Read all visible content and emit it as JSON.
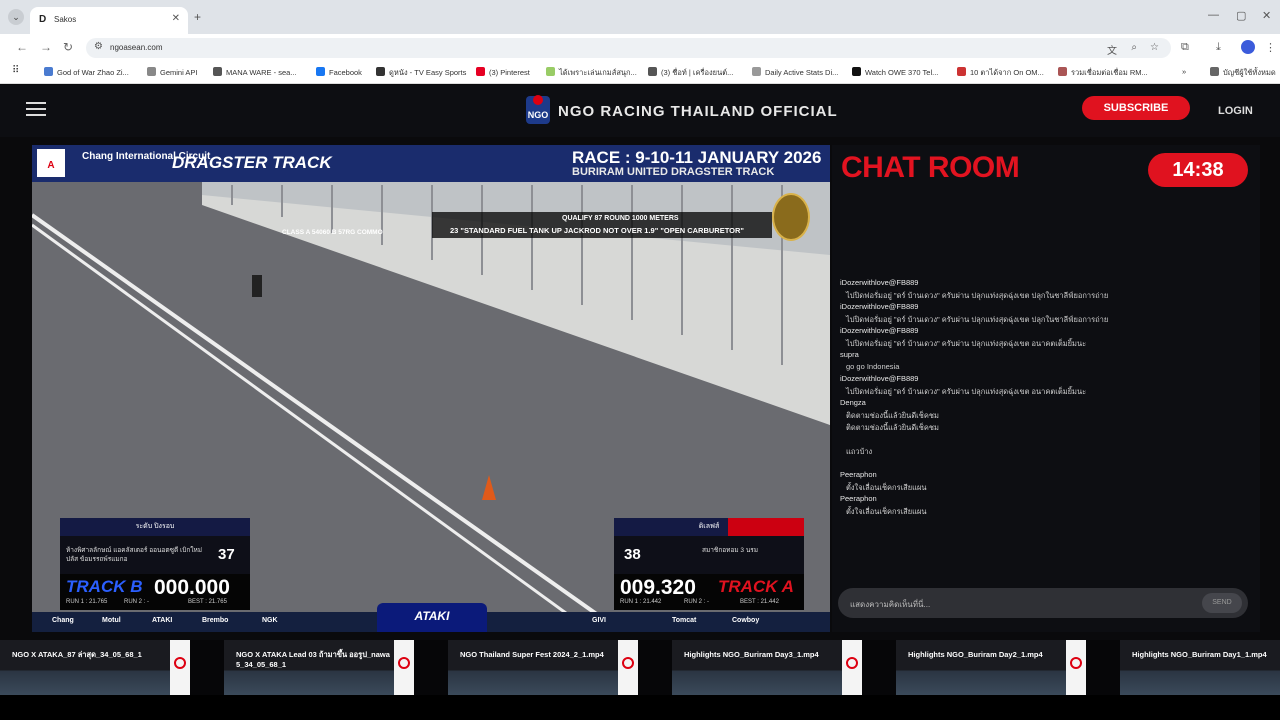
{
  "browser": {
    "tab_title": "Sakos",
    "url": "ngoasean.com",
    "bookmarks": [
      {
        "label": "God of War Zhao Zi...",
        "color": "#4a7bd0"
      },
      {
        "label": "Gemini API",
        "color": "#888"
      },
      {
        "label": "MANA WARE - sea...",
        "color": "#555"
      },
      {
        "label": "Facebook",
        "color": "#1877f2"
      },
      {
        "label": "ดูหนัง - TV Easy Sports",
        "color": "#333"
      },
      {
        "label": "(3) Pinterest",
        "color": "#e60023"
      },
      {
        "label": "ได้เพราะเล่นเกมส์สนุก...",
        "color": "#9c6"
      },
      {
        "label": "(3) ชื่อท์ | เครื่องยนต์...",
        "color": "#555"
      },
      {
        "label": "Daily Active Stats Di...",
        "color": "#999"
      },
      {
        "label": "Watch OWE 370 Tel...",
        "color": "#111"
      },
      {
        "label": "10 ตาได้จาก On OM...",
        "color": "#c33"
      },
      {
        "label": "รวมเชื่อมต่อเชื่อม RM...",
        "color": "#a55"
      },
      {
        "label": "บัญชีผู้ใช้ทั้งหมด",
        "color": "#666"
      }
    ]
  },
  "site": {
    "title": "NGO RACING THAILAND OFFICIAL",
    "subscribe_label": "SUBSCRIBE",
    "login_label": "LOGIN"
  },
  "video": {
    "header_brand": "Chang International Circuit",
    "dragster": "DRAGSTER TRACK",
    "race_title": "RACE : 9-10-11 JANUARY 2026",
    "venue": "BURIRAM UNITED DRAGSTER TRACK",
    "info_a": "QUALIFY 87 ROUND   1000 METERS",
    "info_b": "23 \"STANDARD FUEL TANK UP JACKROD NOT OVER 1.9\" \"OPEN CARBURETOR\"",
    "info_c": "CLASS A 54060 B 57RG COMMO",
    "left_score": {
      "header": "ระดับ ปิงรอบ",
      "name": "ห้างพิศาลลักษณ์ แอคลัสเตอร์ ออนอตซูตี เบิกใหม่ปลัส ข้อมรรถพ์รแมกอ",
      "number": "37",
      "track": "TRACK B",
      "time": "000.000",
      "run1": "RUN 1 : 21.765",
      "run2": "RUN 2 : -",
      "best": "BEST : 21.765"
    },
    "right_score": {
      "header": "ดิเลฟส์",
      "name": "สมาชิกอทอม 3 นรม",
      "number": "38",
      "track": "TRACK A",
      "time": "009.320",
      "run1": "RUN 1 : 21.442",
      "run2": "RUN 2 : -",
      "best": "BEST : 21.442"
    },
    "sponsors": [
      "Chang",
      "Motul",
      "ATAKI",
      "Brembo",
      "NGK",
      "GIVI",
      "Tomcat",
      "Cowboy"
    ],
    "ataki_label": "ATAKI"
  },
  "chat": {
    "title": "CHAT ROOM",
    "timer": "14:38",
    "messages": [
      {
        "user": "iDozerwithlove@FB889",
        "text": "ไปปิดฟอรั่มอยู่ \"ดร์ บ้านเดวง\" ครับผ่าน ปลุกแท่งสุดฉุ่งเขต ปลุกในชาลีฟ์ยอการถ่าย"
      },
      {
        "user": "iDozerwithlove@FB889",
        "text": "ไปปิดฟอรั่มอยู่ \"ดร์ บ้านเดวง\" ครับผ่าน ปลุกแท่งสุดฉุ่งเขต ปลุกในชาลีฟ์ยอการถ่าย"
      },
      {
        "user": "iDozerwithlove@FB889",
        "text": "ไปปิดฟอรั่มอยู่ \"ดร์ บ้านเดวง\" ครับผ่าน ปลุกแท่งสุดฉุ่งเขต อนาคตเต็มยิ้มนะ"
      },
      {
        "user": "supra",
        "text": "go go Indonesia"
      },
      {
        "user": "iDozerwithlove@FB889",
        "text": "ไปปิดฟอรั่มอยู่ \"ดร์ บ้านเดวง\" ครับผ่าน ปลุกแท่งสุดฉุ่งเขต อนาคตเต็มยิ้มนะ"
      },
      {
        "user": "Dengza",
        "text": "ติดตามช่องนี้แล้วยินดีเช็คชม"
      },
      {
        "user": "",
        "text": "ติดตามช่องนี้แล้วยินดีเช็คชม"
      },
      {
        "user": "",
        "text": ""
      },
      {
        "user": "",
        "text": "แถวบ้าง"
      },
      {
        "user": "",
        "text": ""
      },
      {
        "user": "Peeraphon",
        "text": "ตั้งใจเลื่อนเช็คกรเสียแผน"
      },
      {
        "user": "Peeraphon",
        "text": "ตั้งใจเลื่อนเช็คกรเสียแผน"
      }
    ],
    "input_placeholder": "แสดงความคิดเห็นที่นี่...",
    "send_label": "SEND"
  },
  "playlist": [
    {
      "title": "NGO X ATAKA_87 ล่าสุด_34_05_68_1"
    },
    {
      "title": "NGO X ATAKA Lead 03 ถ้ามาขึ้น ออรูป_nawa 5_34_05_68_1"
    },
    {
      "title": "NGO Thailand Super Fest 2024_2_1.mp4"
    },
    {
      "title": "Highlights NGO_Buriram Day3_1.mp4"
    },
    {
      "title": "Highlights NGO_Buriram Day2_1.mp4"
    },
    {
      "title": "Highlights NGO_Buriram Day1_1.mp4"
    }
  ]
}
